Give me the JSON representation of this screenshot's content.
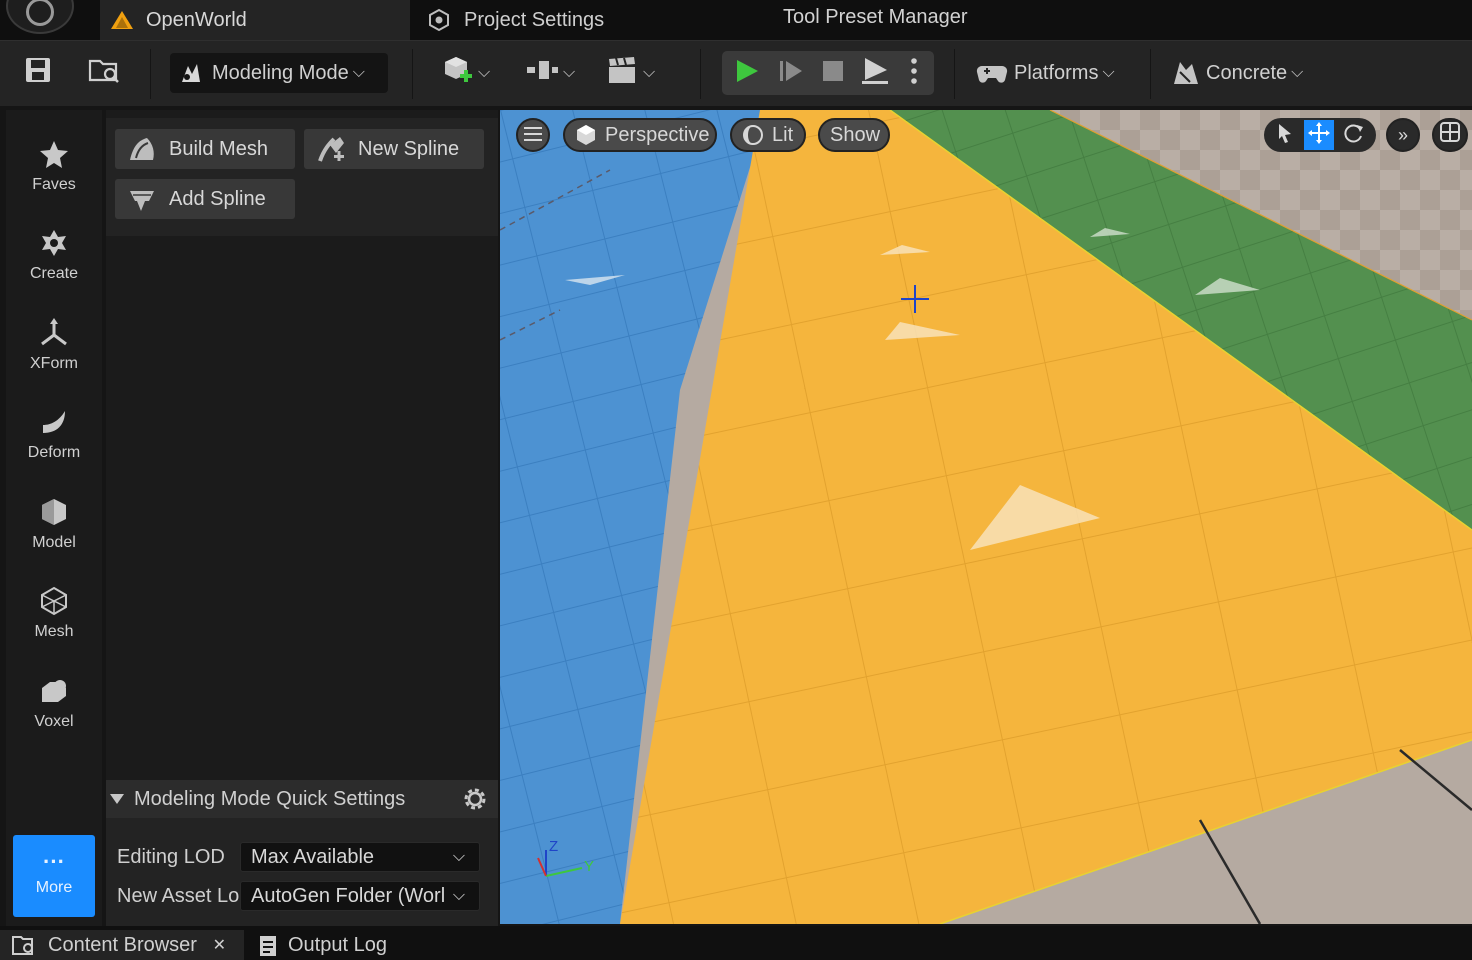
{
  "title_bar": {
    "tabs": [
      {
        "label": "OpenWorld",
        "icon": "level-icon"
      },
      {
        "label": "Project Settings",
        "icon": "settings-cube-icon"
      }
    ],
    "tool_preset_manager": "Tool Preset Manager"
  },
  "toolbar": {
    "mode_label": "Modeling Mode",
    "platforms_label": "Platforms",
    "concrete_label": "Concrete"
  },
  "palette": {
    "items": [
      {
        "label": "Faves",
        "icon": "star-icon"
      },
      {
        "label": "Create",
        "icon": "create-icon"
      },
      {
        "label": "XForm",
        "icon": "xform-icon"
      },
      {
        "label": "Deform",
        "icon": "deform-icon"
      },
      {
        "label": "Model",
        "icon": "model-icon"
      },
      {
        "label": "Mesh",
        "icon": "mesh-icon"
      },
      {
        "label": "Voxel",
        "icon": "voxel-icon"
      }
    ],
    "more_label": "More",
    "more_dots": "···"
  },
  "tool_panel": {
    "buttons": [
      {
        "label": "Build Mesh"
      },
      {
        "label": "New Spline"
      },
      {
        "label": "Add Spline"
      }
    ],
    "quick_settings_title": "Modeling Mode Quick Settings",
    "editing_lod_label": "Editing LOD",
    "editing_lod_value": "Max Available",
    "new_asset_label": "New Asset Lo",
    "new_asset_value": "AutoGen Folder (Worl"
  },
  "viewport": {
    "perspective_label": "Perspective",
    "lit_label": "Lit",
    "show_label": "Show",
    "axis_z": "Z",
    "axis_y": "Y",
    "colors": {
      "blue_lane": "#4a8fd0",
      "yellow_lane": "#f4b33a",
      "green_lane": "#4f8a4c",
      "floor": "#b5aaa1"
    }
  },
  "bottom_bar": {
    "content_browser": "Content Browser",
    "close_glyph": "✕",
    "output_log": "Output Log"
  },
  "colors": {
    "accent": "#1a8cff",
    "play_green": "#3ec73e"
  }
}
